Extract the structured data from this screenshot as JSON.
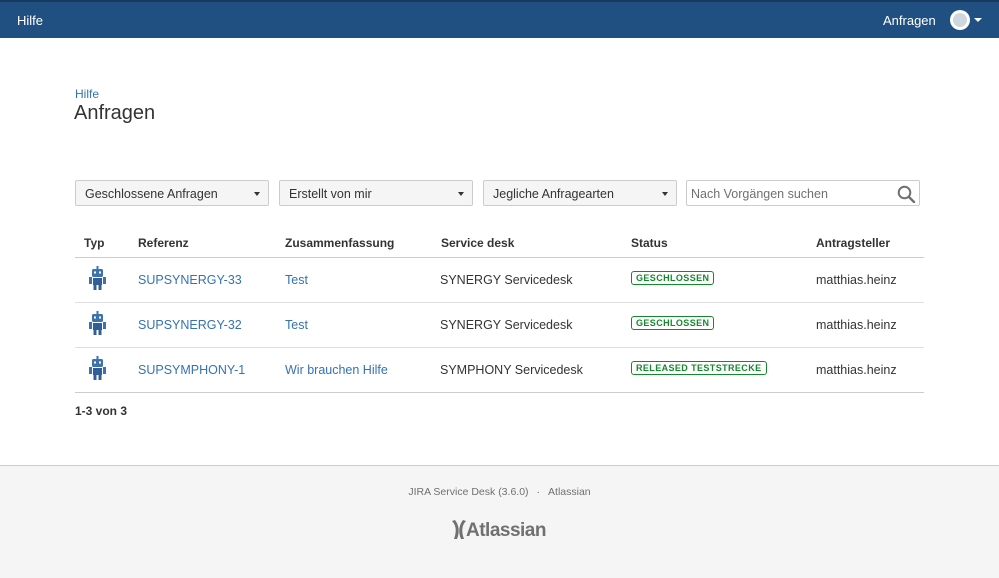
{
  "topbar": {
    "brand": "Hilfe",
    "requests_link": "Anfragen",
    "avatar_icon": "user-avatar-icon",
    "colors": {
      "background": "#205081",
      "text": "#ffffff"
    }
  },
  "breadcrumb": "Hilfe",
  "page_title": "Anfragen",
  "filters": {
    "status": "Geschlossene Anfragen",
    "creator": "Erstellt von mir",
    "request_type": "Jegliche Anfragearten",
    "search_placeholder": "Nach Vorgängen suchen"
  },
  "table": {
    "headers": [
      "Typ",
      "Referenz",
      "Zusammenfassung",
      "Service desk",
      "Status",
      "Antragsteller"
    ],
    "rows": [
      {
        "type_icon": "robot-icon",
        "reference": "SUPSYNERGY-33",
        "summary": "Test",
        "service_desk": "SYNERGY Servicedesk",
        "status": "GESCHLOSSEN",
        "requester": "matthias.heinz"
      },
      {
        "type_icon": "robot-icon",
        "reference": "SUPSYNERGY-32",
        "summary": "Test",
        "service_desk": "SYNERGY Servicedesk",
        "status": "GESCHLOSSEN",
        "requester": "matthias.heinz"
      },
      {
        "type_icon": "robot-icon",
        "reference": "SUPSYMPHONY-1",
        "summary": "Wir brauchen Hilfe",
        "service_desk": "SYMPHONY Servicedesk",
        "status": "RELEASED TESTSTRECKE",
        "requester": "matthias.heinz"
      }
    ],
    "status_color": "#14892c",
    "link_color": "#3572b0"
  },
  "pagination": "1-3 von 3",
  "footer": {
    "product": "JIRA Service Desk (3.6.0)",
    "separator": "·",
    "company": "Atlassian",
    "logo_text": "Atlassian"
  }
}
